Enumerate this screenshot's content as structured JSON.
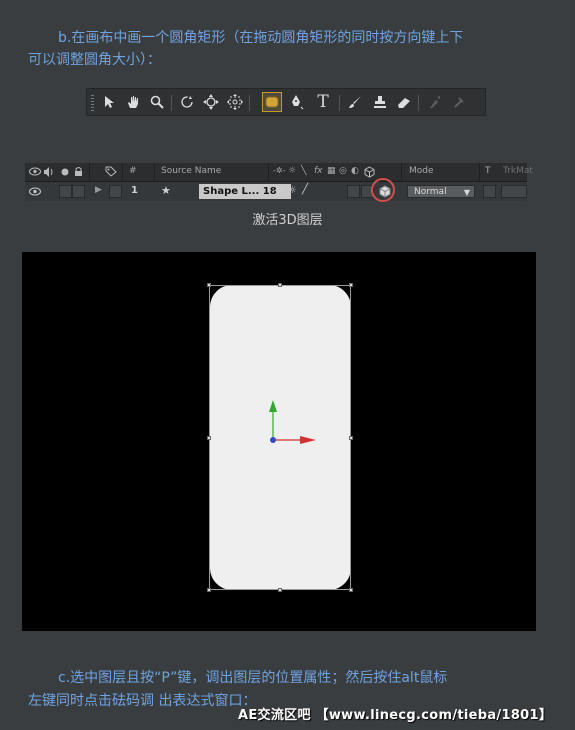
{
  "text": {
    "line1": "b.在画布中画一个圆角矩形（在拖动圆角矩形的同时按方向键上下",
    "line2": "可以调整圆角大小）：",
    "caption": "激活3D图层",
    "line3": "c.选中图层且按“P”键，调出图层的位置属性；然后按住alt鼠标",
    "line4": "左键同时点击砝码调 出表达式窗口：",
    "watermark": "AE交流区吧 【www.linecg.com/tieba/1801】"
  },
  "toolbar": {
    "tools": [
      {
        "name": "selection-tool",
        "icon": "arrow-icon"
      },
      {
        "name": "hand-tool",
        "icon": "hand-icon"
      },
      {
        "name": "zoom-tool",
        "icon": "magnifier-icon"
      },
      {
        "name": "rotation-tool",
        "icon": "rotate-icon"
      },
      {
        "name": "camera-orbit-tool",
        "icon": "orbit-icon"
      },
      {
        "name": "pan-behind-tool",
        "icon": "pan-icon"
      },
      {
        "name": "rectangle-tool",
        "icon": "rounded-rect-icon",
        "active": true
      },
      {
        "name": "pen-tool",
        "icon": "pen-icon"
      },
      {
        "name": "type-tool",
        "icon": "type-icon",
        "glyph": "T"
      },
      {
        "name": "brush-tool",
        "icon": "brush-icon"
      },
      {
        "name": "clone-stamp-tool",
        "icon": "stamp-icon"
      },
      {
        "name": "eraser-tool",
        "icon": "eraser-icon"
      },
      {
        "name": "roto-brush-tool",
        "icon": "roto-icon",
        "disabled": true
      },
      {
        "name": "puppet-tool",
        "icon": "pin-icon",
        "disabled": true
      }
    ]
  },
  "timeline": {
    "header": {
      "num_col": "#",
      "source_name": "Source Name",
      "mode": "Mode",
      "t": "T",
      "trkmat": "TrkMat"
    },
    "layer": {
      "number": "1",
      "name": "Shape L... 18",
      "mode": "Normal"
    }
  },
  "colors": {
    "page_bg": "#3a3d40",
    "paragraph_text": "#6fa3e0",
    "highlight_circle": "#d2504c",
    "active_tool_border": "#c49a2c",
    "shape_fill": "#efefef",
    "axis_x": "#d23232",
    "axis_y": "#2eaa2e",
    "axis_z": "#3348c8"
  }
}
